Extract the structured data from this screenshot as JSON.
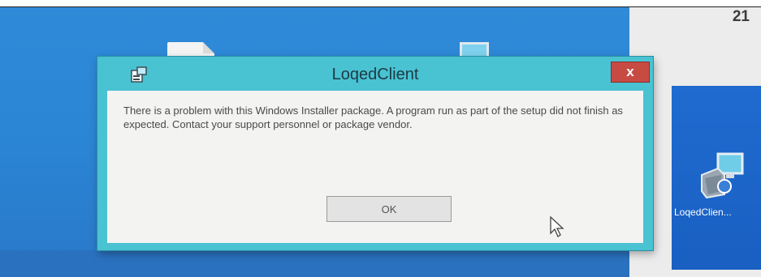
{
  "dialog": {
    "title": "LoqedClient",
    "close_label": "x",
    "message": "There is a problem with this Windows Installer package. A program run as part of the setup did not finish as expected. Contact your support personnel or package vendor.",
    "ok_label": "OK"
  },
  "desktop": {
    "tile_label": "LoqedClien...",
    "clock_partial": "21"
  },
  "colors": {
    "dialog_frame": "#49c2d2",
    "close_button": "#c74b43",
    "desktop_background": "#2f8ad8",
    "tile": "#1f6bd0"
  }
}
